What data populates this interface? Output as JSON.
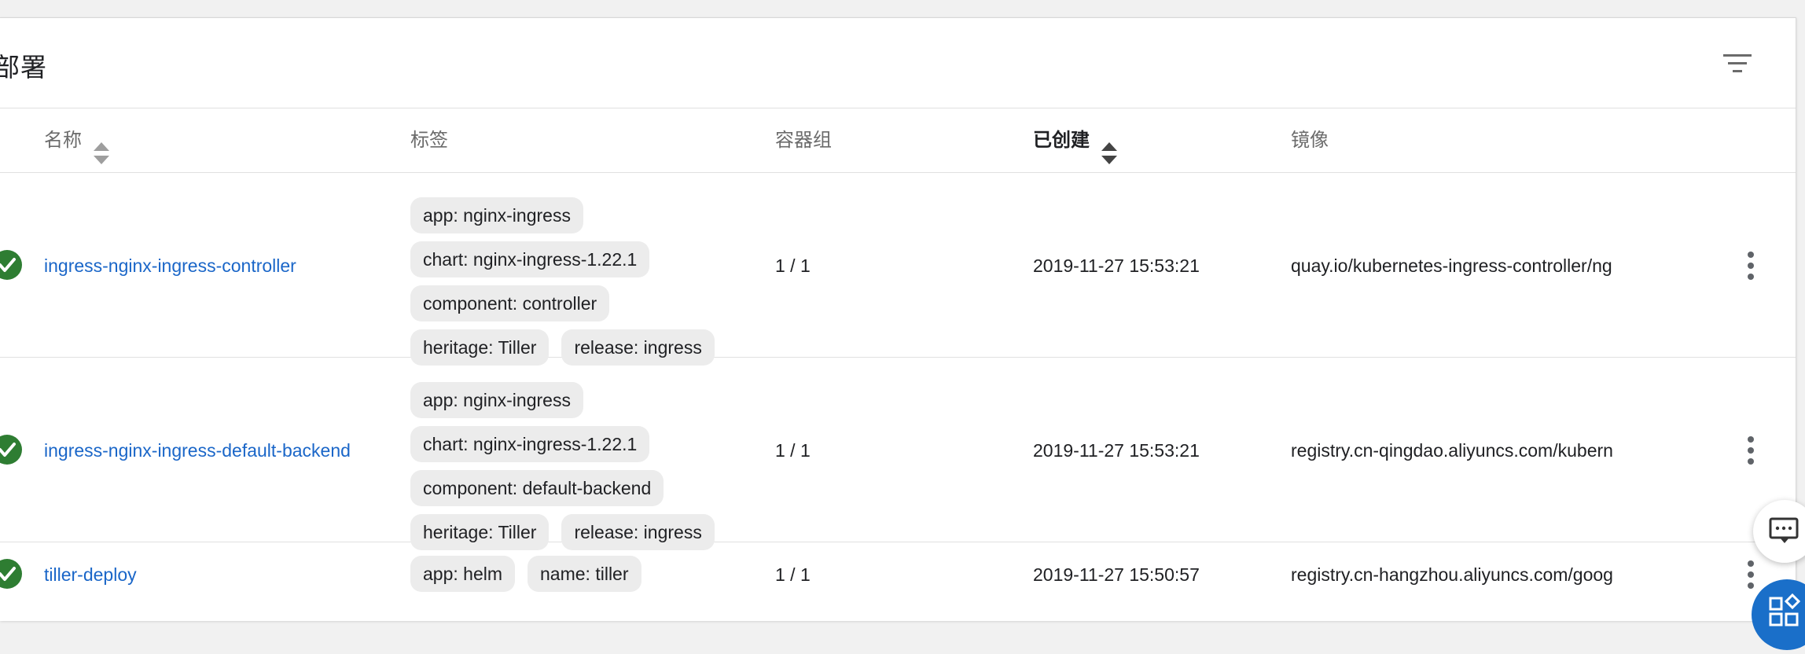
{
  "section": {
    "title": "部署"
  },
  "columns": {
    "name": "名称",
    "labels": "标签",
    "pods": "容器组",
    "created": "已创建",
    "images": "镜像"
  },
  "rows": [
    {
      "name": "ingress-nginx-ingress-controller",
      "label_lines": [
        [
          "app: nginx-ingress"
        ],
        [
          "chart: nginx-ingress-1.22.1"
        ],
        [
          "component: controller"
        ],
        [
          "heritage: Tiller",
          "release: ingress"
        ]
      ],
      "pods": "1 / 1",
      "created": "2019-11-27 15:53:21",
      "image": "quay.io/kubernetes-ingress-controller/ng"
    },
    {
      "name": "ingress-nginx-ingress-default-backend",
      "label_lines": [
        [
          "app: nginx-ingress"
        ],
        [
          "chart: nginx-ingress-1.22.1"
        ],
        [
          "component: default-backend"
        ],
        [
          "heritage: Tiller",
          "release: ingress"
        ]
      ],
      "pods": "1 / 1",
      "created": "2019-11-27 15:53:21",
      "image": "registry.cn-qingdao.aliyuncs.com/kubern"
    },
    {
      "name": "tiller-deploy",
      "label_lines": [
        [
          "app: helm",
          "name: tiller"
        ]
      ],
      "pods": "1 / 1",
      "created": "2019-11-27 15:50:57",
      "image": "registry.cn-hangzhou.aliyuncs.com/goog"
    }
  ],
  "colors": {
    "status_ok": "#2e7d32",
    "link": "#1a66c8",
    "chip_bg": "#ececec",
    "fab_blue": "#1a6fc9"
  },
  "icons": {
    "filter": "filter-icon",
    "sort": "sort-icon",
    "status": "check-circle-icon",
    "more": "more-vert-icon",
    "chat": "chat-icon",
    "apps": "apps-icon"
  }
}
